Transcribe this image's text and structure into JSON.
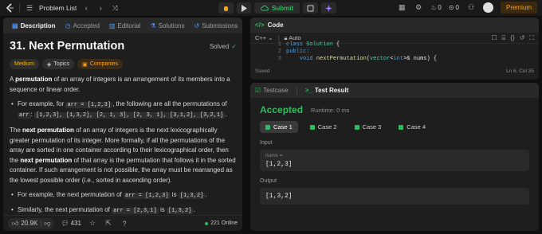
{
  "topbar": {
    "title": "Problem List",
    "submit_label": "Submit",
    "streak_count": "0",
    "notif_count": "0",
    "premium_label": "Premium"
  },
  "left": {
    "tabs": [
      "Description",
      "Accepted",
      "Editorial",
      "Solutions",
      "Submissions"
    ],
    "title": "31. Next Permutation",
    "status": "Solved",
    "tags": [
      "Medium",
      "Topics",
      "Companies"
    ],
    "p1_bold": "permutation",
    "p1_pre": "A ",
    "p1_post": " of an array of integers is an arrangement of its members into a sequence or linear order.",
    "b1_pre": "For example, for ",
    "b1_code": "arr = [1,2,3]",
    "b1_post": ", the following are all the permutations of ",
    "b1_code2": "arr",
    "b1_code3": "[1,2,3], [1,3,2], [2, 1, 3], [2, 3, 1], [3,1,2], [3,2,1]",
    "p2_pre": "The ",
    "p2_bold": "next permutation",
    "p2_mid": " of an array of integers is the next lexicographically greater permutation of its integer. More formally, if all the permutations of the array are sorted in one container according to their lexicographical order, then the ",
    "p2_bold2": "next permutation",
    "p2_mid2": " of that array is the permutation that follows it in the sorted container. If such arrangement is not possible, the array must be rearranged as the lowest possible order (i.e., sorted in ascending order).",
    "b2_pre": "For example, the next permutation of ",
    "b2_code": "arr = [1,2,3]",
    "b2_mid": " is ",
    "b2_code2": "[1,3,2]",
    "b3_pre": "Similarly, the next permutation of ",
    "b3_code": "arr = [2,3,1]",
    "b3_mid": " is ",
    "b3_code2": "[1,3,2]",
    "likes": "20.9K",
    "comments": "431",
    "online": "221 Online"
  },
  "code": {
    "header": "Code",
    "language": "C++",
    "mode": "Auto",
    "lines": [
      {
        "n": "1",
        "text": "class Solution {"
      },
      {
        "n": "2",
        "text": "public:"
      },
      {
        "n": "3",
        "text": "    void nextPermutation(vector<int>& nums) {"
      }
    ],
    "saved": "Saved",
    "position": "Ln 6, Col 35"
  },
  "result": {
    "tabs": [
      "Testcase",
      "Test Result"
    ],
    "status": "Accepted",
    "runtime": "Runtime: 0 ms",
    "cases": [
      "Case 1",
      "Case 2",
      "Case 3",
      "Case 4"
    ],
    "input_label": "Input",
    "input_name": "nums =",
    "input_value": "[1,2,3]",
    "output_label": "Output",
    "output_value": "[1,3,2]"
  },
  "colors": {
    "accepted": "#2cbb5d",
    "premium": "#ffa116",
    "medium": "#ffb800"
  }
}
